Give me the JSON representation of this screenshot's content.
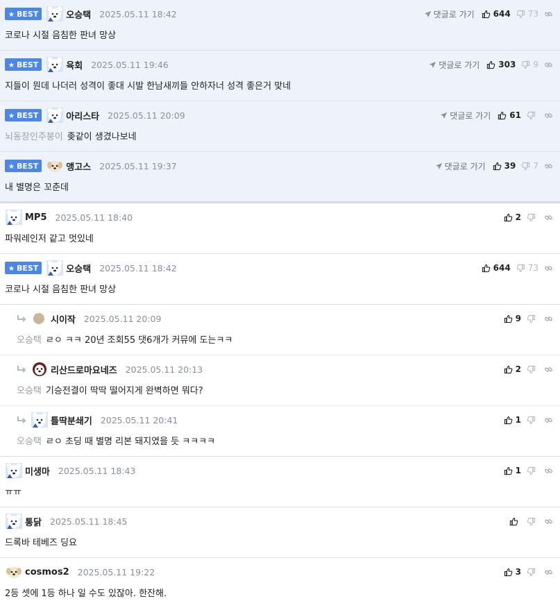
{
  "labels": {
    "best": "BEST",
    "reply_go": "댓글로 가기"
  },
  "colors": {
    "best_badge": "#4a87e8",
    "best_bg": "#eef2fb"
  },
  "icons": {
    "best": "star-icon",
    "reply_go": "paper-plane-icon",
    "upvote": "thumbs-up-icon",
    "downvote": "thumbs-down-icon",
    "link": "link-icon",
    "reply_arrow": "reply-arrow-icon"
  },
  "comments": [
    {
      "best": true,
      "avatar": "bear",
      "nick": "오승택",
      "date": "2025.05.11 18:42",
      "reply_link": true,
      "up": "644",
      "down": "73",
      "to": "",
      "text": "코로나 시절 음침한 판녀 망상"
    },
    {
      "best": true,
      "avatar": "bear",
      "nick": "육회",
      "date": "2025.05.11 19:46",
      "reply_link": true,
      "up": "303",
      "down": "9",
      "to": "",
      "text": "지들이 뭔데 나더러 성격이 좋대 시발 한남새끼들 안하자너 성격 좋은거 맞네"
    },
    {
      "best": true,
      "avatar": "bear",
      "nick": "아리스타",
      "date": "2025.05.11 20:09",
      "reply_link": true,
      "up": "61",
      "down": "",
      "to": "뇌동장인주붕이",
      "text": "좆같이 생겼나보네"
    },
    {
      "best": true,
      "avatar": "puppy",
      "nick": "앵고스",
      "date": "2025.05.11 19:37",
      "reply_link": true,
      "up": "39",
      "down": "7",
      "to": "",
      "text": "내 별명은 꼬춘데"
    },
    {
      "best": false,
      "avatar": "bear",
      "nick": "MP5",
      "date": "2025.05.11 18:40",
      "reply_link": false,
      "up": "2",
      "down": "",
      "to": "",
      "text": "파워레인저 같고 멋있네"
    },
    {
      "best": true,
      "avatar": "bear",
      "nick": "오승택",
      "date": "2025.05.11 18:42",
      "reply_link": false,
      "up": "644",
      "down": "73",
      "to": "",
      "text": "코로나 시절 음침한 판녀 망상"
    },
    {
      "best": false,
      "reply": true,
      "avatar": "dot",
      "nick": "시이작",
      "date": "2025.05.11 20:09",
      "reply_link": false,
      "up": "9",
      "down": "",
      "to": "오승택",
      "text": "ㄹㅇ ㅋㅋ 20년 조회55 댓6개가 커뮤에 도는ㅋㅋ"
    },
    {
      "best": false,
      "reply": true,
      "avatar": "dog",
      "nick": "리산드로마요네즈",
      "date": "2025.05.11 20:13",
      "reply_link": false,
      "up": "2",
      "down": "",
      "to": "오승택",
      "text": "기승전결이 딱딱 떨어지게 완벽하면 뭐다?"
    },
    {
      "best": false,
      "reply": true,
      "avatar": "bear",
      "nick": "틀딱분쇄기",
      "date": "2025.05.11 20:41",
      "reply_link": false,
      "up": "1",
      "down": "",
      "to": "오승택",
      "text": "ㄹㅇ 초딩 때 별명 리본 돼지였을 듯 ㅋㅋㅋㅋ"
    },
    {
      "best": false,
      "avatar": "bear",
      "nick": "미생마",
      "date": "2025.05.11 18:43",
      "reply_link": false,
      "up": "1",
      "down": "",
      "to": "",
      "text": "ㅠㅠ"
    },
    {
      "best": false,
      "avatar": "bear",
      "nick": "통닭",
      "date": "2025.05.11 18:45",
      "reply_link": false,
      "up": "",
      "down": "",
      "to": "",
      "text": "드록바 테베즈 딩요"
    },
    {
      "best": false,
      "avatar": "puppy",
      "nick": "cosmos2",
      "date": "2025.05.11 19:22",
      "reply_link": false,
      "up": "3",
      "down": "",
      "to": "",
      "text": "2등 셋에 1등 하나 일 수도 있잖아. 한잔해."
    }
  ]
}
